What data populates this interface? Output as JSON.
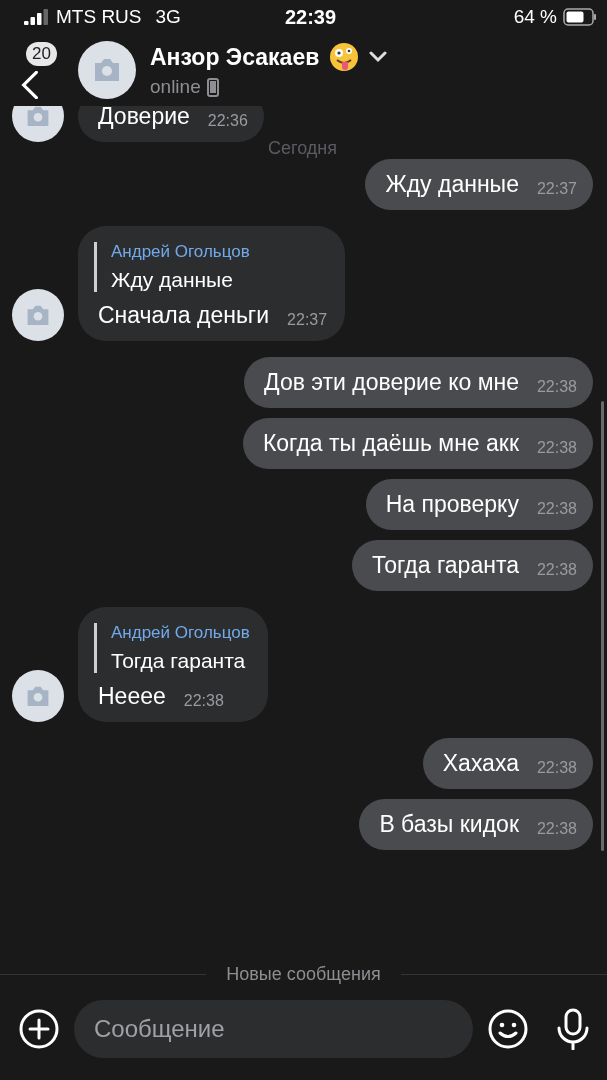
{
  "status_bar": {
    "carrier": "MTS RUS",
    "network": "3G",
    "time": "22:39",
    "battery": "64 %"
  },
  "header": {
    "back_badge": "20",
    "name": "Анзор Эсакаев",
    "status": "online"
  },
  "date_label": "Сегодня",
  "messages": [
    {
      "kind": "incoming",
      "text": "Доверие",
      "time": "22:36"
    },
    {
      "kind": "outgoing",
      "text": "Жду данные",
      "time": "22:37"
    },
    {
      "kind": "incoming",
      "reply": {
        "author": "Андрей Огольцов",
        "text": "Жду данные"
      },
      "text": "Сначала деньги",
      "time": "22:37"
    },
    {
      "kind": "outgoing",
      "text": "Дов эти доверие ко мне",
      "time": "22:38"
    },
    {
      "kind": "outgoing",
      "text": "Когда ты даёшь мне акк",
      "time": "22:38"
    },
    {
      "kind": "outgoing",
      "text": "На проверку",
      "time": "22:38"
    },
    {
      "kind": "outgoing",
      "text": "Тогда гаранта",
      "time": "22:38"
    },
    {
      "kind": "incoming",
      "reply": {
        "author": "Андрей Огольцов",
        "text": "Тогда гаранта"
      },
      "text": "Нееее",
      "time": "22:38"
    },
    {
      "kind": "outgoing",
      "text": "Хахаха",
      "time": "22:38"
    },
    {
      "kind": "outgoing",
      "text": "В базы кидок",
      "time": "22:38"
    }
  ],
  "new_messages_divider": "Новые сообщения",
  "composer": {
    "placeholder": "Сообщение"
  }
}
